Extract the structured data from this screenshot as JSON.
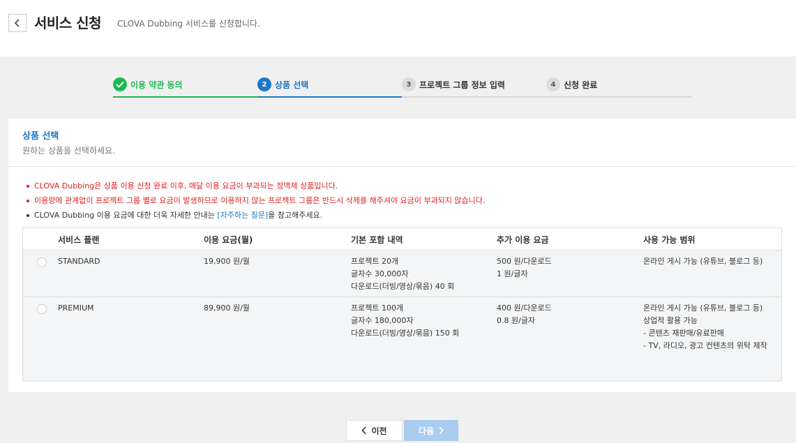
{
  "header": {
    "title": "서비스 신청",
    "subtitle": "CLOVA Dubbing 서비스를 신청합니다."
  },
  "steps": [
    {
      "num": "✓",
      "label": "이용 약관 동의",
      "state": "done"
    },
    {
      "num": "2",
      "label": "상품 선택",
      "state": "active"
    },
    {
      "num": "3",
      "label": "프로젝트 그룹 정보 입력",
      "state": "todo"
    },
    {
      "num": "4",
      "label": "신청 완료",
      "state": "todo"
    }
  ],
  "panel": {
    "title": "상품 선택",
    "subtitle": "원하는 상품을 선택하세요."
  },
  "notices": {
    "line1": "CLOVA Dubbing은 상품 이용 신청 완료 이후, 매달 이용 요금이 부과되는 정액제 상품입니다.",
    "line2": "이용량에 관계없이 프로젝트 그룹 별로 요금이 발생하므로 이용하지 않는 프로젝트 그룹은 반드시 삭제를 해주셔야 요금이 부과되지 않습니다.",
    "line3_pre": "CLOVA Dubbing 이용 요금에 대한 더욱 자세한 안내는 ",
    "line3_link": "[자주하는 질문]",
    "line3_post": "을 참고해주세요."
  },
  "table": {
    "headers": [
      "서비스 플랜",
      "이용 요금(월)",
      "기본 포함 내역",
      "추가 이용 요금",
      "사용 가능 범위"
    ],
    "rows": [
      {
        "plan": "STANDARD",
        "price": "19,900 원/월",
        "basic": [
          "프로젝트 20개",
          "글자수 30,000자",
          "다운로드(더빙/영상/묶음) 40 회"
        ],
        "extra": [
          "500 원/다운로드",
          "1 원/글자"
        ],
        "scope": [
          "온라인 게시 가능 (유튜브, 블로그 등)"
        ]
      },
      {
        "plan": "PREMIUM",
        "price": "89,900 원/월",
        "basic": [
          "프로젝트 100개",
          "글자수 180,000자",
          "다운로드(더빙/영상/묶음) 150 회"
        ],
        "extra": [
          "400 원/다운로드",
          "0.8 원/글자"
        ],
        "scope": [
          "온라인 게시 가능 (유튜브, 블로그 등)",
          "상업적 활용 가능",
          "- 콘텐츠 재판매/유료판매",
          "- TV, 라디오, 광고 컨텐츠의 위탁 제작"
        ]
      }
    ]
  },
  "buttons": {
    "prev": "이전",
    "next": "다음"
  },
  "colors": {
    "done": "#1db954",
    "active": "#1e78c8",
    "warning": "#e02020",
    "next_disabled": "#a9ccef"
  }
}
